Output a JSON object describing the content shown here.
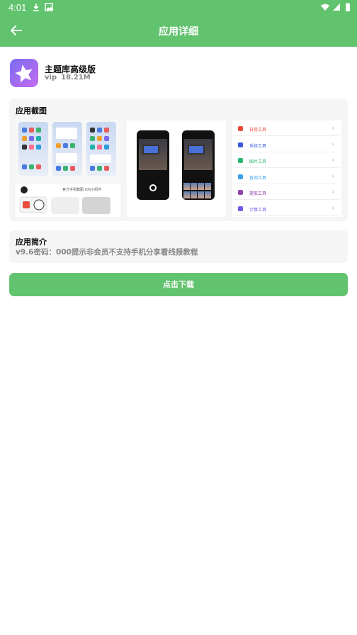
{
  "status_bar": {
    "time": "4:01",
    "icons": [
      "download-icon",
      "photo-icon",
      "wifi-icon",
      "signal-icon",
      "battery-icon"
    ]
  },
  "app_bar": {
    "title": "应用详细",
    "back_icon": "arrow-left-icon"
  },
  "app": {
    "name": "主题库高级版",
    "tag": "vip",
    "size": "18.21M",
    "icon": "star-app-icon"
  },
  "screenshots_section": {
    "title": "应用截图",
    "shot2_caption": "官方手机截图 iOS小组件",
    "tools": [
      "日常工具",
      "系统工具",
      "图片工具",
      "查询工具",
      "提取工具",
      "计算工具"
    ],
    "tool_colors": [
      "#e74c3c",
      "#3b5bdb",
      "#2bb673",
      "#3aa0e8",
      "#8e44ad",
      "#6c5ce7"
    ]
  },
  "intro_section": {
    "title": "应用简介",
    "text": "v9.6密码：000提示非会员不支持手机分享看线报教程"
  },
  "download_button": {
    "label": "点击下载"
  },
  "colors": {
    "accent": "#62c36e",
    "card_bg": "#f5f5f5"
  }
}
